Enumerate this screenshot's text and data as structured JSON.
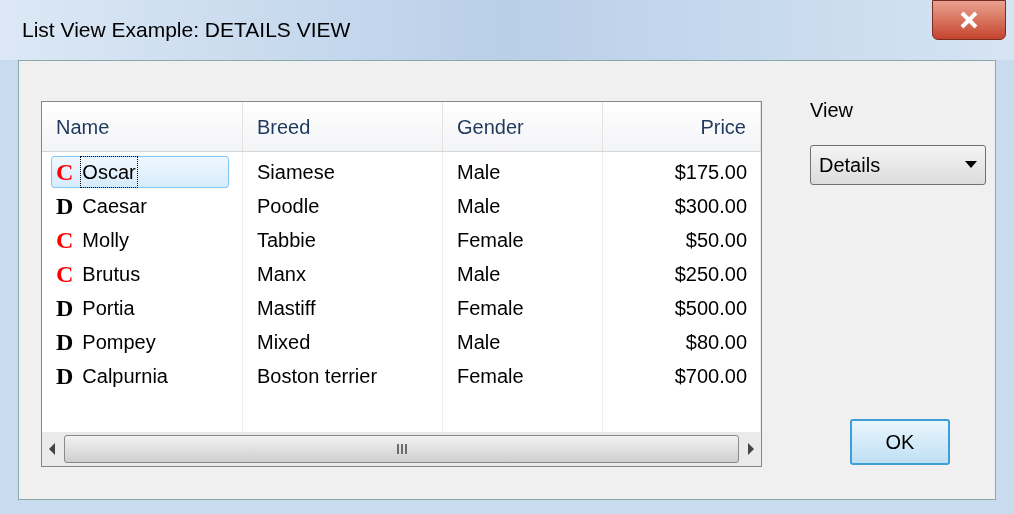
{
  "window": {
    "title": "List View Example: DETAILS VIEW"
  },
  "list": {
    "columns": [
      {
        "label": "Name",
        "kind": "text"
      },
      {
        "label": "Breed",
        "kind": "text"
      },
      {
        "label": "Gender",
        "kind": "text"
      },
      {
        "label": "Price",
        "kind": "money"
      }
    ],
    "rows": [
      {
        "icon": "C",
        "color": "#ff0000",
        "name": "Oscar",
        "breed": "Siamese",
        "gender": "Male",
        "price": "$175.00",
        "selected": true
      },
      {
        "icon": "D",
        "color": "#000000",
        "name": "Caesar",
        "breed": "Poodle",
        "gender": "Male",
        "price": "$300.00",
        "selected": false
      },
      {
        "icon": "C",
        "color": "#ff0000",
        "name": "Molly",
        "breed": "Tabbie",
        "gender": "Female",
        "price": "$50.00",
        "selected": false
      },
      {
        "icon": "C",
        "color": "#ff0000",
        "name": "Brutus",
        "breed": "Manx",
        "gender": "Male",
        "price": "$250.00",
        "selected": false
      },
      {
        "icon": "D",
        "color": "#000000",
        "name": "Portia",
        "breed": "Mastiff",
        "gender": "Female",
        "price": "$500.00",
        "selected": false
      },
      {
        "icon": "D",
        "color": "#000000",
        "name": "Pompey",
        "breed": "Mixed",
        "gender": "Male",
        "price": "$80.00",
        "selected": false
      },
      {
        "icon": "D",
        "color": "#000000",
        "name": "Calpurnia",
        "breed": "Boston terrier",
        "gender": "Female",
        "price": "$700.00",
        "selected": false
      }
    ]
  },
  "view": {
    "label": "View",
    "value": "Details"
  },
  "buttons": [
    "OK"
  ]
}
